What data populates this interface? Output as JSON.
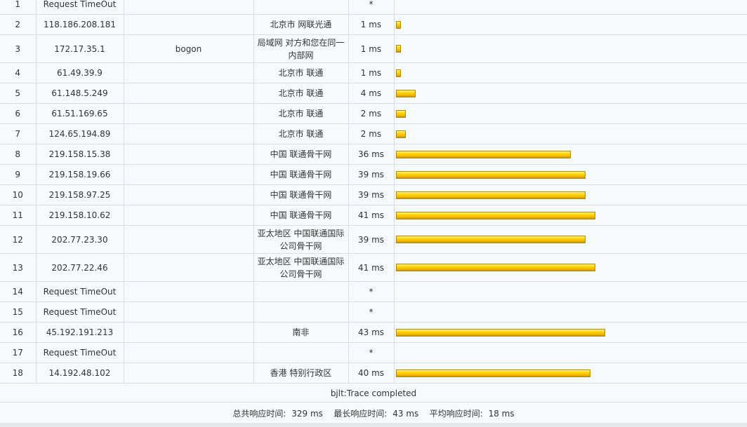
{
  "hops": [
    {
      "hop": "1",
      "ip": "Request TimeOut",
      "host": "",
      "location": "",
      "time": "*",
      "ms": null
    },
    {
      "hop": "2",
      "ip": "118.186.208.181",
      "host": "",
      "location": "北京市 网联光通",
      "time": "1 ms",
      "ms": 1
    },
    {
      "hop": "3",
      "ip": "172.17.35.1",
      "host": "bogon",
      "location": "局域网 对方和您在同一内部网",
      "time": "1 ms",
      "ms": 1
    },
    {
      "hop": "4",
      "ip": "61.49.39.9",
      "host": "",
      "location": "北京市 联通",
      "time": "1 ms",
      "ms": 1
    },
    {
      "hop": "5",
      "ip": "61.148.5.249",
      "host": "",
      "location": "北京市 联通",
      "time": "4 ms",
      "ms": 4
    },
    {
      "hop": "6",
      "ip": "61.51.169.65",
      "host": "",
      "location": "北京市 联通",
      "time": "2 ms",
      "ms": 2
    },
    {
      "hop": "7",
      "ip": "124.65.194.89",
      "host": "",
      "location": "北京市 联通",
      "time": "2 ms",
      "ms": 2
    },
    {
      "hop": "8",
      "ip": "219.158.15.38",
      "host": "",
      "location": "中国 联通骨干网",
      "time": "36 ms",
      "ms": 36
    },
    {
      "hop": "9",
      "ip": "219.158.19.66",
      "host": "",
      "location": "中国 联通骨干网",
      "time": "39 ms",
      "ms": 39
    },
    {
      "hop": "10",
      "ip": "219.158.97.25",
      "host": "",
      "location": "中国 联通骨干网",
      "time": "39 ms",
      "ms": 39
    },
    {
      "hop": "11",
      "ip": "219.158.10.62",
      "host": "",
      "location": "中国 联通骨干网",
      "time": "41 ms",
      "ms": 41
    },
    {
      "hop": "12",
      "ip": "202.77.23.30",
      "host": "",
      "location": "亚太地区 中国联通国际公司骨干网",
      "time": "39 ms",
      "ms": 39
    },
    {
      "hop": "13",
      "ip": "202.77.22.46",
      "host": "",
      "location": "亚太地区 中国联通国际公司骨干网",
      "time": "41 ms",
      "ms": 41
    },
    {
      "hop": "14",
      "ip": "Request TimeOut",
      "host": "",
      "location": "",
      "time": "*",
      "ms": null
    },
    {
      "hop": "15",
      "ip": "Request TimeOut",
      "host": "",
      "location": "",
      "time": "*",
      "ms": null
    },
    {
      "hop": "16",
      "ip": "45.192.191.213",
      "host": "",
      "location": "南非",
      "time": "43 ms",
      "ms": 43
    },
    {
      "hop": "17",
      "ip": "Request TimeOut",
      "host": "",
      "location": "",
      "time": "*",
      "ms": null
    },
    {
      "hop": "18",
      "ip": "14.192.48.102",
      "host": "",
      "location": "香港 特别行政区",
      "time": "40 ms",
      "ms": 40
    }
  ],
  "footer": {
    "completed": "bjlt:Trace completed",
    "total_label": "总共响应时间:",
    "total_value": "329 ms",
    "max_label": "最长响应时间:",
    "max_value": "43 ms",
    "avg_label": "平均响应时间:",
    "avg_value": "18 ms"
  },
  "colors": {
    "bar": "#ffd700",
    "border": "#dcdcec",
    "background": "#f5fafc"
  }
}
